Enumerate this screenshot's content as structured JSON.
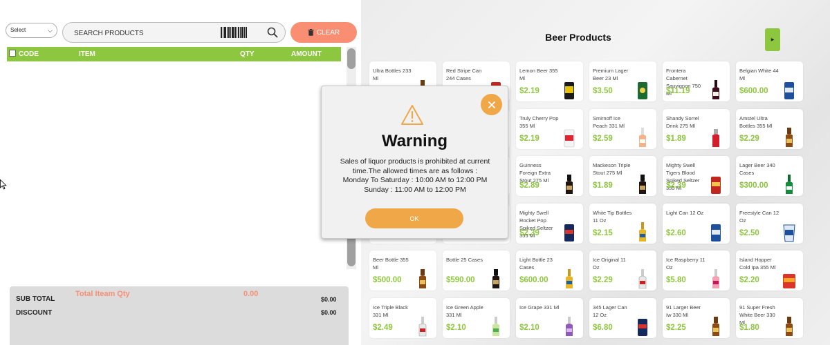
{
  "cart": {
    "select_label": "Select",
    "search_placeholder": "SEARCH PRODUCTS",
    "clear_label": "CLEAR",
    "columns": {
      "code": "CODE",
      "item": "ITEM",
      "qty": "QTY",
      "amount": "AMOUNT"
    }
  },
  "totals": {
    "sub_total_label": "SUB TOTAL",
    "discount_label": "DISCOUNT",
    "total_qty_label": "Total Iteam Qty",
    "total_qty_value": "0.00",
    "sub_total_value": "$0.00",
    "discount_value": "$0.00"
  },
  "products_panel": {
    "title": "Beer Products",
    "products": [
      {
        "name": "Ultra Bottles 233 Ml",
        "price": "",
        "thumb": "bottle-amber"
      },
      {
        "name": "Red Stripe Can 244 Cases",
        "price": "",
        "thumb": "can-red"
      },
      {
        "name": "Lemon Beer 355 Ml",
        "price": "$2.19",
        "thumb": "can-black"
      },
      {
        "name": "Premium Lager Beer 23 Ml",
        "price": "$3.50",
        "thumb": "can-green"
      },
      {
        "name": "Frontera Cabernet Sauvignon 750 Ml",
        "price": "$11.19",
        "thumb": "bottle-wine"
      },
      {
        "name": "Belgian White 44 Ml",
        "price": "$600.00",
        "thumb": "can-blue"
      },
      {
        "name": "",
        "price": "",
        "thumb": ""
      },
      {
        "name": "",
        "price": "",
        "thumb": ""
      },
      {
        "name": "Truly Cherry Pop 355 Ml",
        "price": "$2.19",
        "thumb": "can-white"
      },
      {
        "name": "Smirnoff Ice Peach 331 Ml",
        "price": "$2.59",
        "thumb": "bottle-peach"
      },
      {
        "name": "Shandy Sorrel Drink 275 Ml",
        "price": "$1.89",
        "thumb": "bottle-red"
      },
      {
        "name": "Amstel Ultra Bottles 355 Ml",
        "price": "$2.29",
        "thumb": "bottle-amber"
      },
      {
        "name": "",
        "price": "",
        "thumb": ""
      },
      {
        "name": "",
        "price": "",
        "thumb": ""
      },
      {
        "name": "Guinness Foreign Extra Stout 275 Ml",
        "price": "$2.89",
        "thumb": "bottle-dark"
      },
      {
        "name": "Mackeson Triple Stout 275 Ml",
        "price": "$1.89",
        "thumb": "bottle-dark"
      },
      {
        "name": "Mighty Swell Tigers Blood Spiked Seltzer 355 Ml",
        "price": "$2.39",
        "thumb": "can-red"
      },
      {
        "name": "Lager Beer 340 Cases",
        "price": "$300.00",
        "thumb": "bottle-green"
      },
      {
        "name": "",
        "price": "",
        "thumb": ""
      },
      {
        "name": "",
        "price": "",
        "thumb": ""
      },
      {
        "name": "Mighty Swell Rocket Pop Spiked Seltzer 355 Ml",
        "price": "$2.39",
        "thumb": "can-navy"
      },
      {
        "name": "White Tip Bottles 11 Oz",
        "price": "$2.15",
        "thumb": "bottle-gold"
      },
      {
        "name": "Light Can 12 Oz",
        "price": "$2.60",
        "thumb": "can-blue"
      },
      {
        "name": "Freestyle Can 12 Oz",
        "price": "$2.50",
        "thumb": "cup-blue"
      },
      {
        "name": "Beer Bottle 355 Ml",
        "price": "$500.00",
        "thumb": "bottle-amber"
      },
      {
        "name": "Bottle 25 Cases",
        "price": "$590.00",
        "thumb": "bottle-dark"
      },
      {
        "name": "Light Bottle 23 Cases",
        "price": "$600.00",
        "thumb": "bottle-gold"
      },
      {
        "name": "Ice Original 11 Oz",
        "price": "$2.29",
        "thumb": "bottle-clear"
      },
      {
        "name": "Ice Raspberry 11 Oz",
        "price": "$5.80",
        "thumb": "bottle-pink"
      },
      {
        "name": "Island Hopper Cold Ipa 355 Ml",
        "price": "$2.20",
        "thumb": "can-orange"
      },
      {
        "name": "Ice Triple Black 331 Ml",
        "price": "$2.49",
        "thumb": "bottle-clear"
      },
      {
        "name": "Ice Green Apple 331 Ml",
        "price": "$2.10",
        "thumb": "bottle-lime"
      },
      {
        "name": "Ice Grape 331 Ml",
        "price": "$2.10",
        "thumb": "bottle-purple"
      },
      {
        "name": "345 Lager Can 12 Oz",
        "price": "$6.80",
        "thumb": "can-navy"
      },
      {
        "name": "91 Larger Beer Iw 330 Ml",
        "price": "$2.25",
        "thumb": "bottle-amber"
      },
      {
        "name": "91 Super Fresh White Beer 330 Ml",
        "price": "$1.80",
        "thumb": "bottle-amber"
      }
    ]
  },
  "modal": {
    "title": "Warning",
    "message_lines": [
      "Sales of liquor products is prohibited at current",
      "time.The allowed times are as follows :",
      "Monday To Saturday : 10:00 AM to 12:00 PM",
      "Sunday : 11:00 AM to 12:00 PM"
    ],
    "ok_label": "OK"
  },
  "colors": {
    "accent_green": "#8dc63f",
    "clear_salmon": "#f98e72",
    "modal_orange": "#f0a748"
  }
}
